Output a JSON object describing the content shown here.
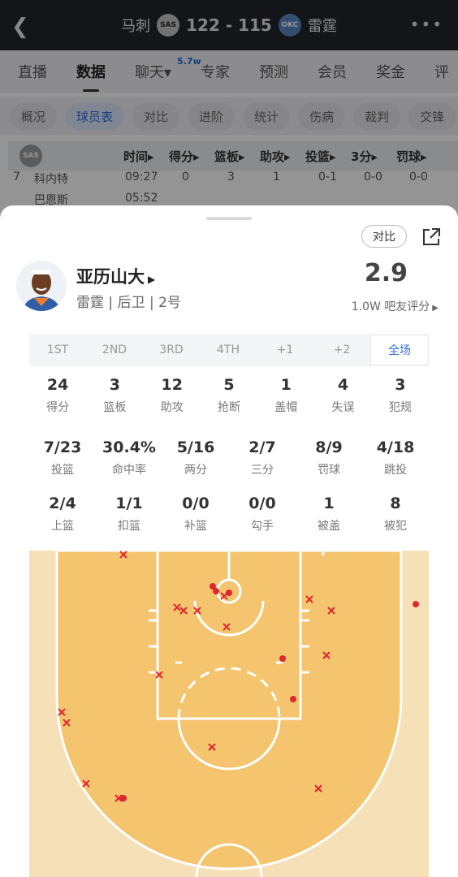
{
  "header": {
    "home_team": "马刺",
    "home_logo": "SAS",
    "score": "122 - 115",
    "away_logo": "OKC",
    "away_team": "雷霆"
  },
  "tabs": [
    {
      "label": "直播"
    },
    {
      "label": "数据"
    },
    {
      "label": "聊天"
    },
    {
      "label": "专家"
    },
    {
      "label": "预测"
    },
    {
      "label": "会员"
    },
    {
      "label": "奖金"
    },
    {
      "label": "评"
    }
  ],
  "chat_badge": "5.7w",
  "subtabs": [
    "概况",
    "球员表",
    "对比",
    "进阶",
    "统计",
    "伤病",
    "裁判",
    "交锋"
  ],
  "table": {
    "team_logo": "SAS",
    "headers": [
      "时间",
      "得分",
      "篮板",
      "助攻",
      "投篮",
      "3分",
      "罚球"
    ],
    "row": {
      "num": "7",
      "name": "科内特",
      "time": "09:27",
      "pts": "0",
      "reb": "3",
      "ast": "1",
      "fg": "0-1",
      "tp": "0-0",
      "ft": "0-0"
    },
    "row2": {
      "name": "巴恩斯",
      "time": "05:52"
    }
  },
  "player": {
    "name": "亚历山大",
    "info": "雷霆 | 后卫 | 2号",
    "rating": "2.9",
    "rating_label": "1.0W 吧友评分",
    "compare_label": "对比"
  },
  "quarters": [
    "1ST",
    "2ND",
    "3RD",
    "4TH",
    "+1",
    "+2",
    "全场"
  ],
  "stats_row1": [
    {
      "value": "24",
      "label": "得分"
    },
    {
      "value": "3",
      "label": "篮板"
    },
    {
      "value": "12",
      "label": "助攻"
    },
    {
      "value": "5",
      "label": "抢断"
    },
    {
      "value": "1",
      "label": "盖帽"
    },
    {
      "value": "4",
      "label": "失误"
    },
    {
      "value": "3",
      "label": "犯规"
    }
  ],
  "stats_row2": [
    {
      "value": "7/23",
      "label": "投篮"
    },
    {
      "value": "30.4%",
      "label": "命中率"
    },
    {
      "value": "5/16",
      "label": "两分"
    },
    {
      "value": "2/7",
      "label": "三分"
    },
    {
      "value": "8/9",
      "label": "罚球"
    },
    {
      "value": "4/18",
      "label": "跳投"
    }
  ],
  "stats_row3": [
    {
      "value": "2/4",
      "label": "上篮"
    },
    {
      "value": "1/1",
      "label": "扣篮"
    },
    {
      "value": "0/0",
      "label": "补篮"
    },
    {
      "value": "0/0",
      "label": "勾手"
    },
    {
      "value": "1",
      "label": "被盖"
    },
    {
      "value": "8",
      "label": "被犯"
    }
  ],
  "colors": {
    "accent": "#2f6cde",
    "court": "#f4c56e",
    "court_outer": "#f6e0b7",
    "made": "#e0262f",
    "miss": "#e0262f"
  }
}
